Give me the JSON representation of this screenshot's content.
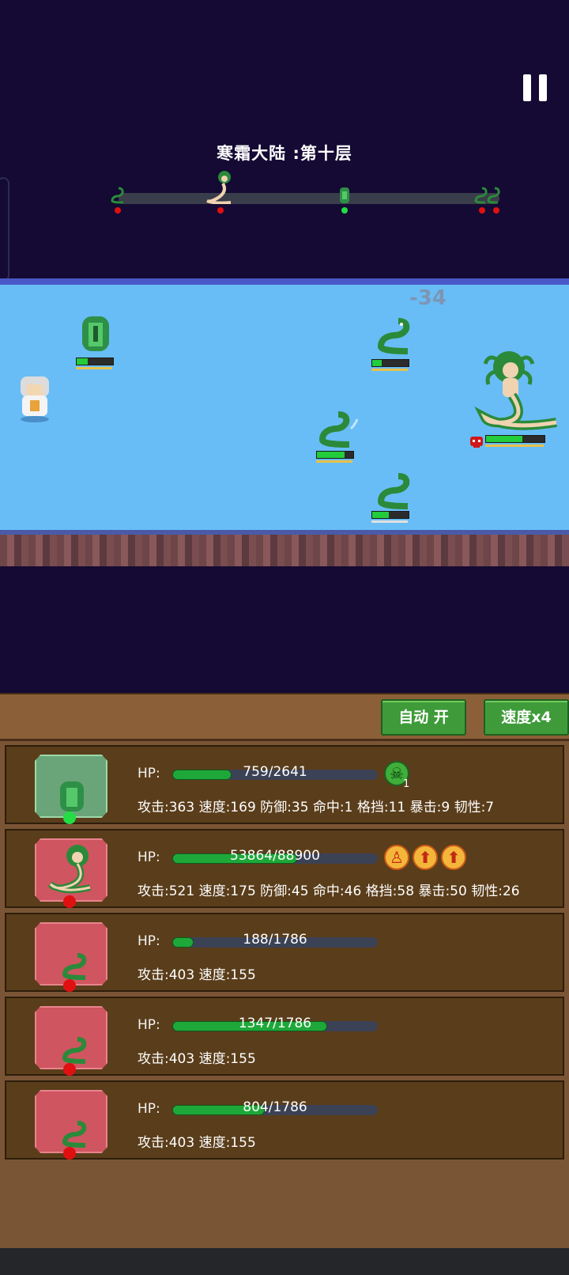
{
  "stage": {
    "title": "寒霜大陆 :第十层"
  },
  "battle": {
    "damage_text": "-34"
  },
  "controls": {
    "auto_label": "自动 开",
    "speed_label": "速度x4"
  },
  "colors": {
    "ally_dot": "#22dd44",
    "enemy_dot": "#e01010",
    "hp_fill": "#1fa83a"
  },
  "units": [
    {
      "name": "green knight",
      "side": "ally",
      "hp_text": "759/2641",
      "hp_fraction": 0.287,
      "stats": "攻击:363 速度:169 防御:35 命中:1 格挡:11 暴击:9 韧性:7",
      "effects": [
        {
          "icon": "skull-icon",
          "count": "1"
        }
      ]
    },
    {
      "name": "medusa",
      "side": "enemy",
      "hp_text": "53864/88900",
      "hp_fraction": 0.606,
      "stats": "攻击:521 速度:175 防御:45 命中:46 格挡:58 暴击:50 韧性:26",
      "effects": [
        {
          "icon": "figure-icon"
        },
        {
          "icon": "up-arrow-icon"
        },
        {
          "icon": "up-arrow-icon"
        }
      ]
    },
    {
      "name": "snake",
      "side": "enemy",
      "hp_text": "188/1786",
      "hp_fraction": 0.105,
      "stats": "攻击:403 速度:155",
      "effects": []
    },
    {
      "name": "snake",
      "side": "enemy",
      "hp_text": "1347/1786",
      "hp_fraction": 0.754,
      "stats": "攻击:403 速度:155",
      "effects": []
    },
    {
      "name": "snake",
      "side": "enemy",
      "hp_text": "804/1786",
      "hp_fraction": 0.45,
      "stats": "攻击:403 速度:155",
      "effects": []
    }
  ]
}
